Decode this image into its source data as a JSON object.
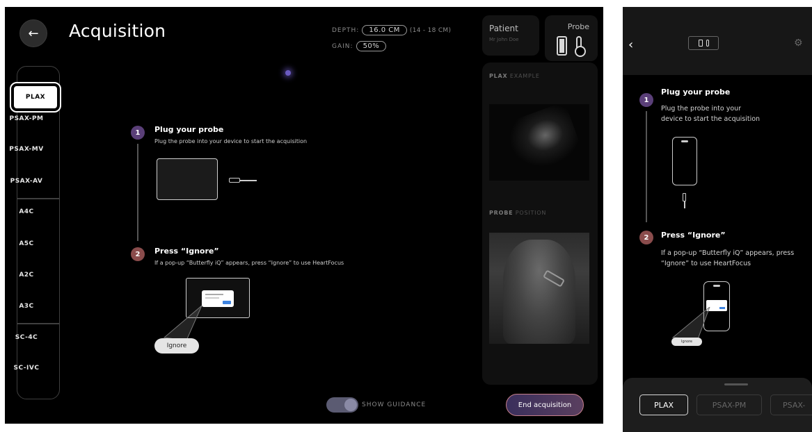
{
  "tablet": {
    "title": "Acquisition",
    "depth": {
      "label": "DEPTH:",
      "value": "16.0 CM",
      "range": "(14 - 18 CM)"
    },
    "gain": {
      "label": "GAIN:",
      "value": "50%"
    },
    "patient": {
      "label": "Patient",
      "name": "Mr John Doe"
    },
    "probe": {
      "label": "Probe"
    },
    "views": [
      "PLAX",
      "PSAX-PM",
      "PSAX-MV",
      "PSAX-AV",
      "A4C",
      "A5C",
      "A2C",
      "A3C",
      "SC-4C",
      "SC-IVC"
    ],
    "active_view": "PLAX",
    "steps": [
      {
        "number": "1",
        "title": "Plug your probe",
        "description": "Plug the probe into your device to start the acquisition"
      },
      {
        "number": "2",
        "title": "Press “Ignore”",
        "description": "If a pop-up “Butterfly iQ” appears, press “Ignore” to use HeartFocus"
      }
    ],
    "ignore_label": "Ignore",
    "example": {
      "bold": "PLAX",
      "label": " EXAMPLE"
    },
    "position": {
      "bold": "PROBE",
      "label": " POSITION"
    },
    "guidance_label": "SHOW GUIDANCE",
    "end_button": "End acquisition"
  },
  "phone": {
    "steps": [
      {
        "number": "1",
        "title": "Plug your probe",
        "description": "Plug the probe into your device to start the acquisition"
      },
      {
        "number": "2",
        "title": "Press “Ignore”",
        "description": "If a pop-up “Butterfly iQ” appears, press “Ignore” to use HeartFocus"
      }
    ],
    "ignore_label": "Ignore",
    "tabs": [
      "PLAX",
      "PSAX-PM",
      "PSAX-"
    ]
  },
  "icons": {
    "back": "arrow-left-icon",
    "phone_back": "chevron-left-icon",
    "settings": "gear-icon",
    "probe": "probe-icon",
    "thermometer": "thermometer-icon"
  },
  "colors": {
    "background": "#000000",
    "step1": "#5a3f78",
    "step2": "#8a4c4c",
    "end_button_border": "#c67f8a"
  }
}
